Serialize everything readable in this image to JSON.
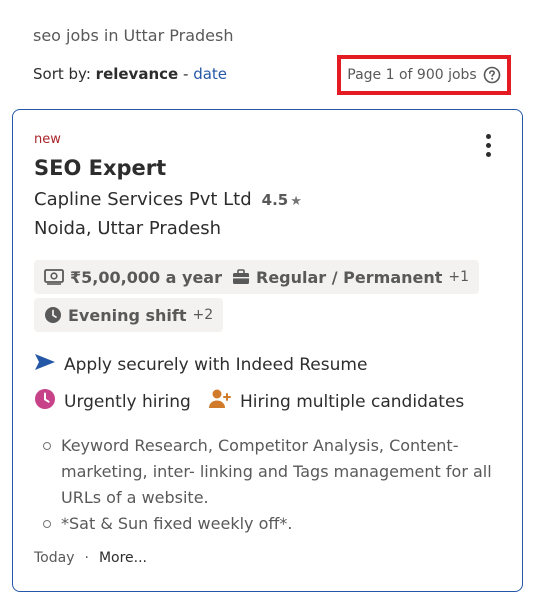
{
  "search": {
    "query_text": "seo jobs in Uttar Pradesh",
    "sort_label": "Sort by:",
    "sort_active": "relevance",
    "sort_separator": "-",
    "sort_alt": "date",
    "pager_text": "Page 1 of 900 jobs"
  },
  "job": {
    "badge": "new",
    "title": "SEO Expert",
    "company": "Capline Services Pvt Ltd",
    "rating": "4.5",
    "location": "Noida, Uttar Pradesh",
    "salary": "₹5,00,000 a year",
    "job_type": "Regular / Permanent",
    "job_type_more": "+1",
    "shift": "Evening shift",
    "shift_more": "+2",
    "apply_text": "Apply securely with Indeed Resume",
    "urgent_text": "Urgently hiring",
    "multi_text": "Hiring multiple candidates",
    "snippets": [
      "Keyword Research, Competitor Analysis, Content-marketing, inter- linking and Tags management for all URLs of a website.",
      "*Sat & Sun fixed weekly off*."
    ],
    "posted": "Today",
    "footer_dot": "·",
    "more_link": "More..."
  },
  "colors": {
    "accent_blue": "#2557a7",
    "new_badge": "#a9252b",
    "highlight_border": "#e51b23",
    "urgent_icon": "#c74289",
    "multi_icon": "#d07a2c"
  },
  "icons": {
    "help": "help-circle-icon",
    "kebab": "more-vertical-icon",
    "star": "star-icon",
    "salary": "money-icon",
    "job_type": "briefcase-icon",
    "shift": "clock-icon",
    "apply": "send-arrow-icon",
    "urgent": "urgent-clock-icon",
    "multi": "add-person-icon"
  }
}
